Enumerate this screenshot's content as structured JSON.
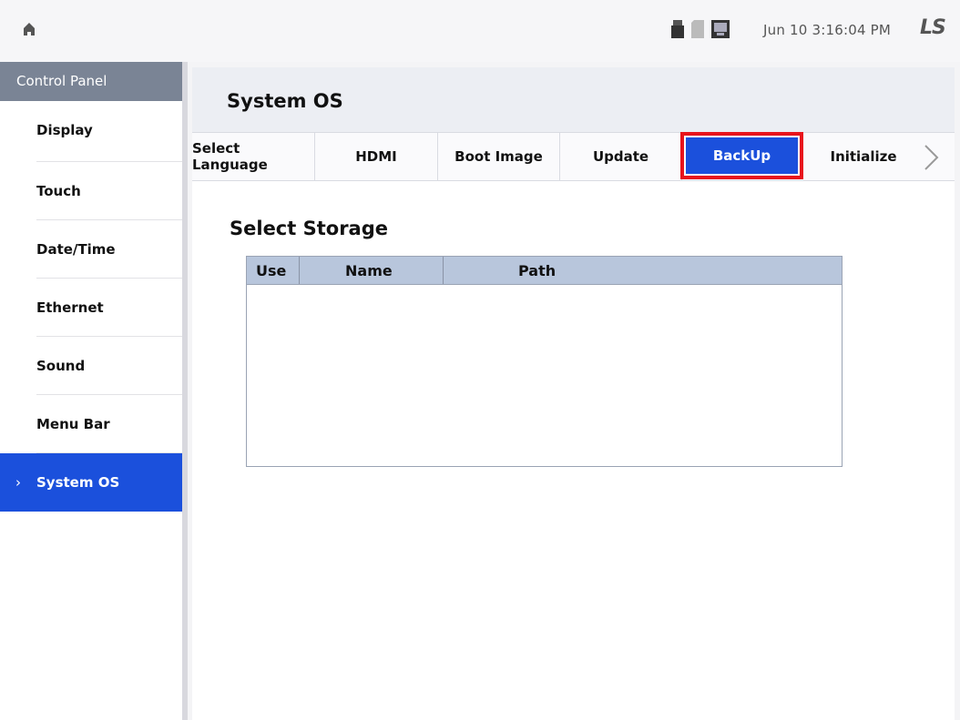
{
  "topbar": {
    "datetime": "Jun 10 3:16:04 PM",
    "brand": "LS",
    "icons": [
      "home-icon",
      "usb-icon",
      "sd-card-icon",
      "network-icon"
    ]
  },
  "sidebar": {
    "header": "Control Panel",
    "items": [
      {
        "label": "Display"
      },
      {
        "label": "Touch"
      },
      {
        "label": "Date/Time"
      },
      {
        "label": "Ethernet"
      },
      {
        "label": "Sound"
      },
      {
        "label": "Menu Bar"
      },
      {
        "label": "System OS",
        "active": true
      }
    ]
  },
  "main": {
    "title": "System OS",
    "tabs": [
      {
        "label": "Select Language"
      },
      {
        "label": "HDMI"
      },
      {
        "label": "Boot Image"
      },
      {
        "label": "Update"
      },
      {
        "label": "BackUp",
        "active": true
      },
      {
        "label": "Initialize"
      }
    ],
    "section_title": "Select Storage",
    "table": {
      "columns": [
        "Use",
        "Name",
        "Path"
      ],
      "rows": []
    }
  },
  "colors": {
    "accent": "#1b50dc",
    "highlight": "#e8141c",
    "sidebar_header": "#7a8495",
    "table_header": "#b8c6dc"
  }
}
